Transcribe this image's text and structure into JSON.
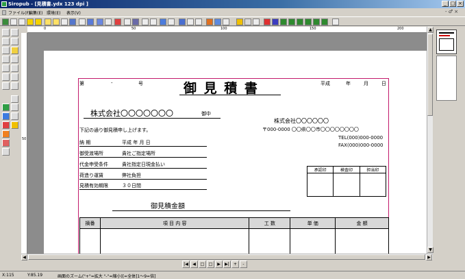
{
  "window": {
    "title": "Siropub - [見積書.ydx  123 dpi ]",
    "min": "_",
    "max": "□",
    "close": "×"
  },
  "menu": {
    "items": [
      "ファイル(F)",
      "編集(E)",
      "環境(E)",
      "表示(V)"
    ],
    "mdi": "- ♂ ×"
  },
  "doc": {
    "no_prefix": "第",
    "no_dash": "-",
    "no_suffix": "号",
    "title": "御 見 積 書",
    "date_era": "平成",
    "date_year": "年",
    "date_month": "月",
    "date_day": "日",
    "recipient": "株式会社〇〇〇〇〇〇〇",
    "honorific": "御中",
    "sender_company": "株式会社〇〇〇〇〇〇",
    "sender_address": "〒000-0000 〇〇県〇〇市〇〇〇〇〇〇〇〇",
    "sender_tel": "TEL(000)000-0000",
    "sender_fax": "FAX(000)000-0000",
    "intro": "下記の通り御見積申し上げます。",
    "fields": [
      {
        "label": "納      期",
        "value": "平成    年    月    日"
      },
      {
        "label": "御受渡場所",
        "value": "貴社ご指定場所"
      },
      {
        "label": "代金申受条件",
        "value": "貴社指定日現金払い"
      },
      {
        "label": "荷造り運賃",
        "value": "弊社負担"
      },
      {
        "label": "見積有効期限",
        "value": "３０日間"
      }
    ],
    "stamps": [
      "承認印",
      "検査印",
      "担当印"
    ],
    "total_label": "御見積金額",
    "columns": [
      "摘番",
      "項 目 内 容",
      "工 数",
      "単 価",
      "金 額"
    ]
  },
  "ruler": {
    "h_marks": [
      "0",
      "50",
      "100",
      "150",
      "200"
    ],
    "v_marks": [
      "50"
    ]
  },
  "status": {
    "x": "X:115",
    "y": "Y:85.19",
    "hint": "画面のズーム(\"+\"=拡大 \"-\"=縮小)[=全体]1〜9=倍]"
  }
}
